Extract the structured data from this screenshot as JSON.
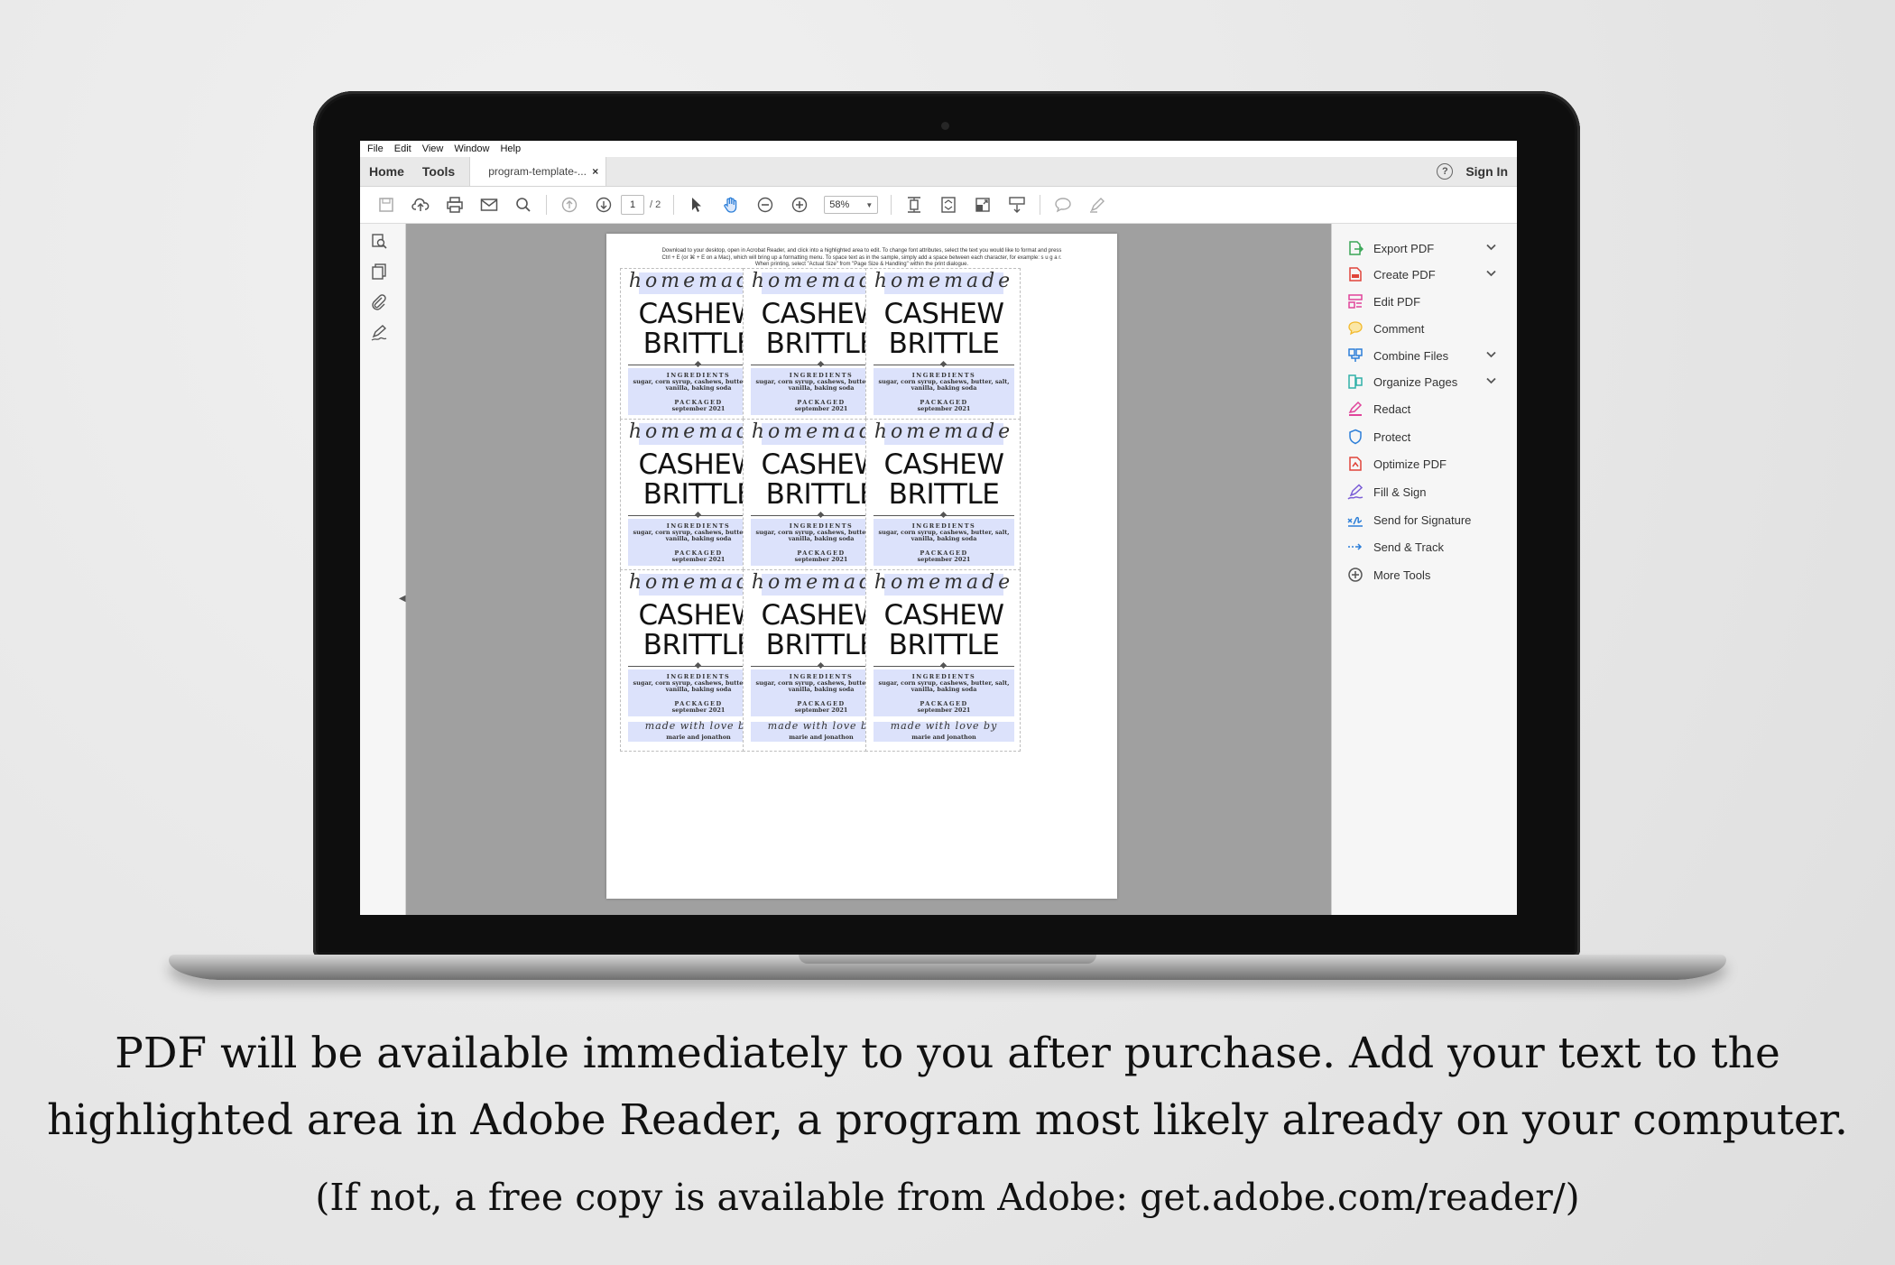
{
  "window": {
    "menu": [
      "File",
      "Edit",
      "View",
      "Window",
      "Help"
    ],
    "tabs": {
      "home": "Home",
      "tools": "Tools",
      "document": "program-template-...",
      "close": "×"
    },
    "sign_in": "Sign In",
    "help_glyph": "?"
  },
  "toolbar": {
    "page_current": "1",
    "page_total": "/ 2",
    "zoom": "58%",
    "icons": [
      "save-icon",
      "upload-icon",
      "print-icon",
      "email-icon",
      "search-icon",
      "prev-page-icon",
      "next-page-icon",
      "select-cursor-icon",
      "hand-icon",
      "zoom-out-icon",
      "zoom-in-icon",
      "fit-page-icon",
      "full-page-icon",
      "rotate-icon",
      "scroll-mode-icon",
      "comment-icon",
      "highlight-pen-icon"
    ]
  },
  "document": {
    "instructions": "Download to your desktop, open in Acrobat Reader, and click into a highlighted area to edit. To change font attributes, select the text you would like to format and press Ctrl + E (or ⌘ + E on a Mac), which will bring up a formatting menu. To space text as in the sample, simply add a space between each character, for example: s u g a r. When printing, select \"Actual Size\" from \"Page Size & Handling\" within the print dialogue.",
    "label": {
      "script_top": "homemade",
      "title_line1": "CASHEW",
      "title_line2": "BRITTLE",
      "ingredients_title": "INGREDIENTS",
      "ingredients": "sugar, corn syrup, cashews, butter, salt, vanilla, baking soda",
      "packaged_title": "PACKAGED",
      "packaged_date": "september 2021",
      "made_with_love": "made with love by",
      "names": "marie and jonathon"
    },
    "label_count": 9
  },
  "right_panel": {
    "tools": [
      {
        "label": "Export PDF",
        "icon": "export-pdf-icon",
        "color": "#3aa657",
        "expandable": true
      },
      {
        "label": "Create PDF",
        "icon": "create-pdf-icon",
        "color": "#e0443a",
        "expandable": true
      },
      {
        "label": "Edit PDF",
        "icon": "edit-pdf-icon",
        "color": "#e0449a",
        "expandable": false
      },
      {
        "label": "Comment",
        "icon": "comment-icon",
        "color": "#f2b92c",
        "expandable": false
      },
      {
        "label": "Combine Files",
        "icon": "combine-files-icon",
        "color": "#2d7fd8",
        "expandable": true
      },
      {
        "label": "Organize Pages",
        "icon": "organize-pages-icon",
        "color": "#31b1a8",
        "expandable": true
      },
      {
        "label": "Redact",
        "icon": "redact-icon",
        "color": "#e0449a",
        "expandable": false
      },
      {
        "label": "Protect",
        "icon": "protect-icon",
        "color": "#2d7fd8",
        "expandable": false
      },
      {
        "label": "Optimize PDF",
        "icon": "optimize-pdf-icon",
        "color": "#e0443a",
        "expandable": false
      },
      {
        "label": "Fill & Sign",
        "icon": "fill-sign-icon",
        "color": "#7a5cd6",
        "expandable": false
      },
      {
        "label": "Send for Signature",
        "icon": "send-signature-icon",
        "color": "#2d7fd8",
        "expandable": false
      },
      {
        "label": "Send & Track",
        "icon": "send-track-icon",
        "color": "#2d7fd8",
        "expandable": false
      },
      {
        "label": "More Tools",
        "icon": "more-tools-icon",
        "color": "#555555",
        "expandable": false
      }
    ]
  },
  "caption": {
    "line1": "PDF will be available immediately to you after purchase.  Add your text to the",
    "line2": "highlighted area in Adobe Reader, a program most likely already on your computer.",
    "line3": "(If not, a free copy is available from Adobe: get.adobe.com/reader/)"
  },
  "colors": {
    "highlight": "#dce2fb",
    "doc_background": "#a0a0a0",
    "page": "#ffffff"
  }
}
